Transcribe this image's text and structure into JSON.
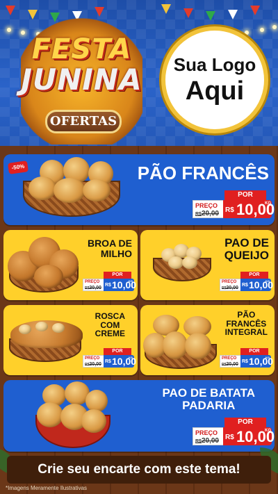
{
  "header": {
    "festa_line1": "FESTA",
    "festa_line2": "JUNINA",
    "ofertas": "OFERTAS",
    "logo_line1": "Sua Logo",
    "logo_line2": "Aqui"
  },
  "products": [
    {
      "name": "PÃO FRANCÊS",
      "discount": "-50%",
      "por_label": "POR",
      "preco_label": "PREÇO",
      "old_currency": "R$",
      "old_price": "20,00",
      "currency": "R$",
      "price": "10,00",
      "unit": "KG"
    },
    {
      "name_line1": "BROA DE",
      "name_line2": "MILHO",
      "por_label": "POR",
      "preco_label": "PREÇO",
      "old_currency": "R$",
      "old_price": "20,00",
      "currency": "R$",
      "price": "10,00",
      "unit": "KG"
    },
    {
      "name_line1": "PAO DE",
      "name_line2": "QUEIJO",
      "por_label": "POR",
      "preco_label": "PREÇO",
      "old_currency": "R$",
      "old_price": "20,00",
      "currency": "R$",
      "price": "10,00",
      "unit": "KG"
    },
    {
      "name_line1": "ROSCA",
      "name_line2": "COM",
      "name_line3": "CREME",
      "por_label": "POR",
      "preco_label": "PREÇO",
      "old_currency": "R$",
      "old_price": "20,00",
      "currency": "R$",
      "price": "10,00",
      "unit": "KG"
    },
    {
      "name_line1": "PÃO",
      "name_line2": "FRANCÊS",
      "name_line3": "INTEGRAL",
      "por_label": "POR",
      "preco_label": "PREÇO",
      "old_currency": "R$",
      "old_price": "20,00",
      "currency": "R$",
      "price": "10,00",
      "unit": "KG"
    },
    {
      "name_line1": "PAO DE BATATA",
      "name_line2": "PADARIA",
      "por_label": "POR",
      "preco_label": "PREÇO",
      "old_currency": "R$",
      "old_price": "20,00",
      "currency": "R$",
      "price": "10,00",
      "unit": "KG"
    }
  ],
  "footer": {
    "cta": "Crie seu encarte com este tema!",
    "disclaimer": "*Imagens Meramente Ilustrativas"
  },
  "colors": {
    "blue_card": "#1f5fd0",
    "yellow_card": "#ffd02a",
    "price_red": "#e02020",
    "wood": "#6b3718"
  }
}
